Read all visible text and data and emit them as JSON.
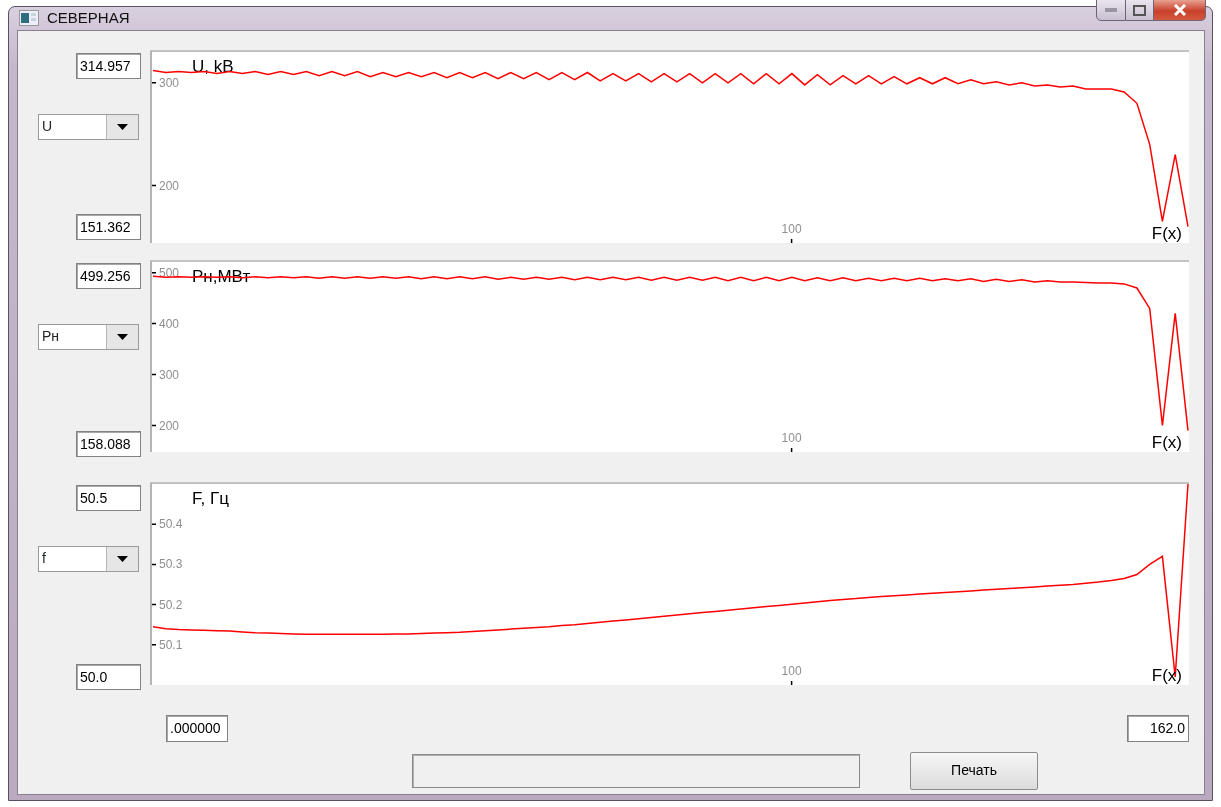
{
  "window": {
    "title": "СЕВЕРНАЯ"
  },
  "panels": [
    {
      "max_value": "314.957",
      "min_value": "151.362",
      "chart_data": {
        "type": "line",
        "title": "U, kВ",
        "xlabel": "F(x)",
        "ylim": [
          144,
          330
        ],
        "yticks": [
          200,
          300
        ],
        "annotations": [
          "100"
        ],
        "series": [
          {
            "name": "U",
            "color": "#ff0000",
            "values": [
              312,
              310,
              311,
              310,
              311,
              309,
              311,
              309,
              311,
              308,
              311,
              308,
              311,
              307,
              311,
              307,
              311,
              306,
              310,
              306,
              310,
              306,
              310,
              305,
              310,
              305,
              310,
              304,
              310,
              304,
              310,
              303,
              310,
              303,
              310,
              302,
              309,
              302,
              309,
              301,
              309,
              301,
              309,
              300,
              309,
              300,
              309,
              299,
              309,
              299,
              309,
              298,
              308,
              298,
              307,
              299,
              307,
              299,
              306,
              299,
              305,
              299,
              305,
              299,
              303,
              299,
              301,
              298,
              300,
              297,
              298,
              296,
              297,
              294,
              294,
              294,
              291,
              280,
              240,
              165,
              230,
              160
            ]
          }
        ]
      }
    },
    {
      "max_value": "499.256",
      "min_value": "158.088",
      "chart_data": {
        "type": "line",
        "title": "Рн,МВт",
        "xlabel": "F(x)",
        "ylim": [
          148,
          521
        ],
        "yticks": [
          200,
          300,
          400,
          500
        ],
        "annotations": [
          "100"
        ],
        "series": [
          {
            "name": "Рн",
            "color": "#ff0000",
            "values": [
              493,
              491,
              492,
              491,
              492,
              491,
              492,
              490,
              492,
              490,
              492,
              490,
              492,
              489,
              492,
              489,
              492,
              489,
              492,
              489,
              492,
              488,
              492,
              488,
              492,
              488,
              492,
              487,
              491,
              487,
              491,
              487,
              491,
              486,
              491,
              486,
              491,
              486,
              491,
              485,
              491,
              485,
              491,
              485,
              491,
              484,
              491,
              484,
              491,
              484,
              491,
              484,
              490,
              484,
              490,
              484,
              489,
              484,
              489,
              484,
              489,
              484,
              488,
              484,
              488,
              483,
              487,
              483,
              486,
              482,
              484,
              482,
              482,
              481,
              480,
              480,
              478,
              470,
              430,
              200,
              420,
              190
            ]
          }
        ]
      }
    },
    {
      "max_value": "50.5",
      "min_value": "50.0",
      "chart_data": {
        "type": "line",
        "title": "F, Гц",
        "xlabel": "F(x)",
        "ylim": [
          50.0,
          50.5
        ],
        "yticks": [
          50.1,
          50.2,
          50.3,
          50.4
        ],
        "annotations": [
          "100"
        ],
        "series": [
          {
            "name": "f",
            "color": "#ff0000",
            "values": [
              50.145,
              50.14,
              50.138,
              50.137,
              50.136,
              50.135,
              50.134,
              50.132,
              50.13,
              50.129,
              50.128,
              50.127,
              50.126,
              50.126,
              50.126,
              50.126,
              50.126,
              50.126,
              50.126,
              50.127,
              50.127,
              50.128,
              50.129,
              50.13,
              50.131,
              50.133,
              50.135,
              50.137,
              50.139,
              50.141,
              50.143,
              50.145,
              50.148,
              50.15,
              50.153,
              50.156,
              50.159,
              50.162,
              50.165,
              50.168,
              50.171,
              50.174,
              50.177,
              50.18,
              50.183,
              50.186,
              50.189,
              50.192,
              50.195,
              50.198,
              50.201,
              50.204,
              50.207,
              50.21,
              50.213,
              50.215,
              50.218,
              50.22,
              50.222,
              50.224,
              50.226,
              50.228,
              50.23,
              50.232,
              50.234,
              50.236,
              50.238,
              50.24,
              50.242,
              50.244,
              50.246,
              50.248,
              50.25,
              50.253,
              50.256,
              50.26,
              50.265,
              50.275,
              50.3,
              50.32,
              50.02,
              50.5
            ]
          }
        ]
      }
    }
  ],
  "x_range": {
    "min": ".000000",
    "max": "162.0"
  },
  "print_button": "Печать"
}
